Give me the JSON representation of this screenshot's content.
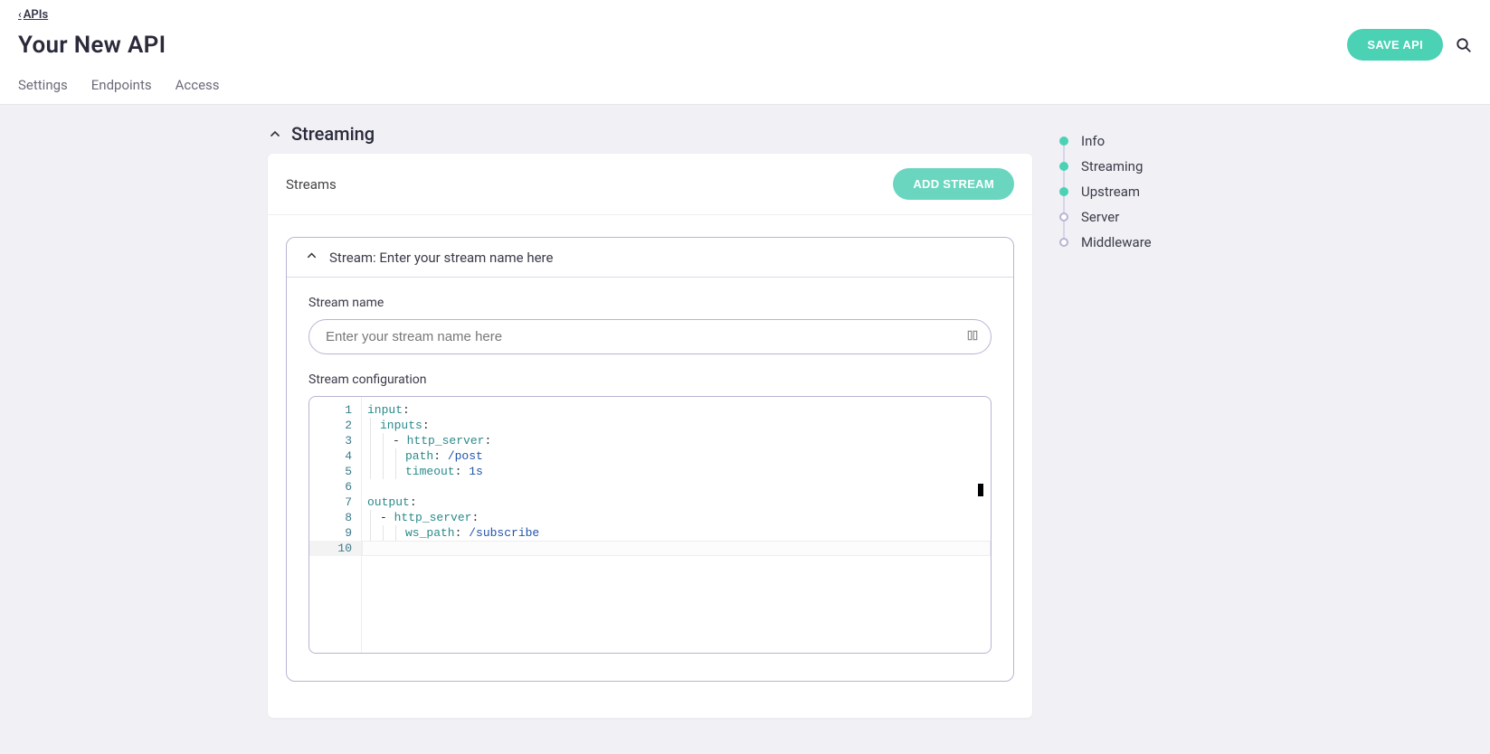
{
  "breadcrumb": {
    "label": "APIs"
  },
  "page": {
    "title": "Your New API"
  },
  "actions": {
    "save": "SAVE API"
  },
  "tabs": {
    "settings": "Settings",
    "endpoints": "Endpoints",
    "access": "Access"
  },
  "section": {
    "heading": "Streaming"
  },
  "panel": {
    "title": "Streams",
    "add_button": "ADD STREAM"
  },
  "stream": {
    "header_prefix": "Stream: ",
    "header_value": "Enter your stream name here",
    "name_label": "Stream name",
    "name_placeholder": "Enter your stream name here",
    "config_label": "Stream configuration"
  },
  "code": {
    "line_numbers": [
      "1",
      "2",
      "3",
      "4",
      "5",
      "6",
      "7",
      "8",
      "9",
      "10"
    ],
    "lines": [
      {
        "tokens": [
          {
            "t": "input",
            "c": "key"
          },
          {
            "t": ":",
            "c": "punc"
          }
        ]
      },
      {
        "indent": 1,
        "tokens": [
          {
            "t": "inputs",
            "c": "key"
          },
          {
            "t": ":",
            "c": "punc"
          }
        ]
      },
      {
        "indent": 2,
        "tokens": [
          {
            "t": "- ",
            "c": "punc"
          },
          {
            "t": "http_server",
            "c": "key"
          },
          {
            "t": ":",
            "c": "punc"
          }
        ]
      },
      {
        "indent": 3,
        "tokens": [
          {
            "t": "path",
            "c": "key"
          },
          {
            "t": ": ",
            "c": "punc"
          },
          {
            "t": "/post",
            "c": "val"
          }
        ]
      },
      {
        "indent": 3,
        "tokens": [
          {
            "t": "timeout",
            "c": "key"
          },
          {
            "t": ": ",
            "c": "punc"
          },
          {
            "t": "1s",
            "c": "val"
          }
        ]
      },
      {
        "tokens": []
      },
      {
        "tokens": [
          {
            "t": "output",
            "c": "key"
          },
          {
            "t": ":",
            "c": "punc"
          }
        ]
      },
      {
        "indent": 1,
        "tokens": [
          {
            "t": "- ",
            "c": "punc"
          },
          {
            "t": "http_server",
            "c": "key"
          },
          {
            "t": ":",
            "c": "punc"
          }
        ]
      },
      {
        "indent": 3,
        "tokens": [
          {
            "t": "ws_path",
            "c": "key"
          },
          {
            "t": ": ",
            "c": "punc"
          },
          {
            "t": "/subscribe",
            "c": "val"
          }
        ]
      },
      {
        "active": true,
        "tokens": []
      }
    ]
  },
  "sidenav": {
    "items": [
      {
        "label": "Info",
        "done": true
      },
      {
        "label": "Streaming",
        "done": true
      },
      {
        "label": "Upstream",
        "done": true
      },
      {
        "label": "Server",
        "done": false
      },
      {
        "label": "Middleware",
        "done": false
      }
    ]
  }
}
